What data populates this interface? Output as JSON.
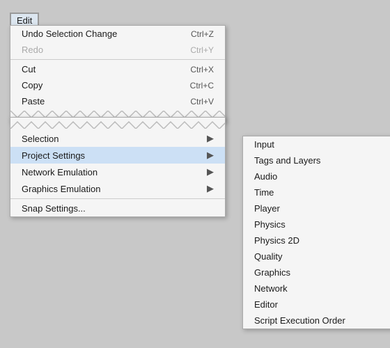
{
  "menubar": {
    "edit_label": "Edit"
  },
  "edit_dropdown": {
    "items": [
      {
        "label": "Undo Selection Change",
        "shortcut": "Ctrl+Z",
        "disabled": false
      },
      {
        "label": "Redo",
        "shortcut": "Ctrl+Y",
        "disabled": true
      },
      {
        "separator": true
      },
      {
        "label": "Cut",
        "shortcut": "Ctrl+X",
        "disabled": false
      },
      {
        "label": "Copy",
        "shortcut": "Ctrl+C",
        "disabled": false
      },
      {
        "label": "Paste",
        "shortcut": "Ctrl+V",
        "disabled": false
      }
    ]
  },
  "context_dropdown": {
    "items": [
      {
        "label": "Selection",
        "arrow": true
      },
      {
        "label": "Project Settings",
        "arrow": true,
        "highlighted": true
      },
      {
        "label": "Network Emulation",
        "arrow": true
      },
      {
        "label": "Graphics Emulation",
        "arrow": true
      },
      {
        "separator": true
      },
      {
        "label": "Snap Settings..."
      }
    ]
  },
  "submenu": {
    "items": [
      {
        "label": "Input"
      },
      {
        "label": "Tags and Layers"
      },
      {
        "label": "Audio"
      },
      {
        "label": "Time"
      },
      {
        "label": "Player"
      },
      {
        "label": "Physics"
      },
      {
        "label": "Physics 2D"
      },
      {
        "label": "Quality"
      },
      {
        "label": "Graphics"
      },
      {
        "label": "Network"
      },
      {
        "label": "Editor"
      },
      {
        "label": "Script Execution Order"
      }
    ]
  }
}
